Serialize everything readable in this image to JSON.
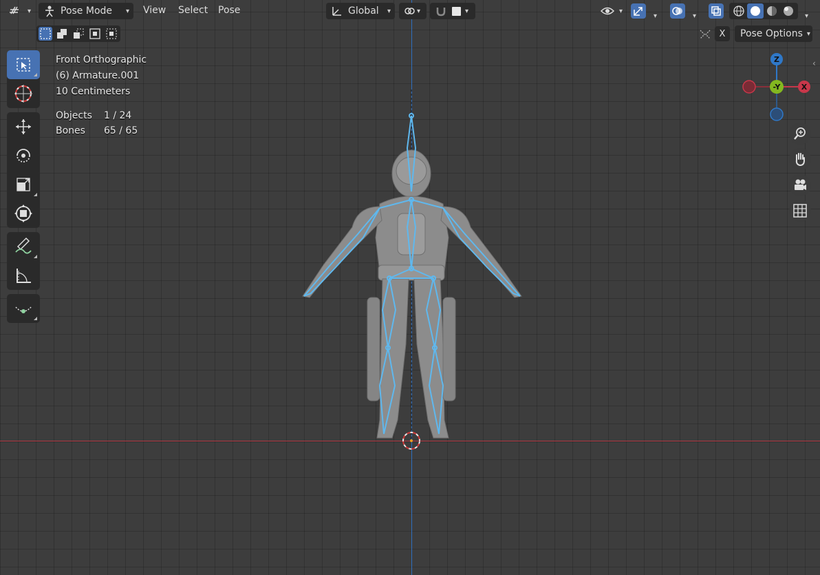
{
  "header": {
    "mode_label": "Pose Mode",
    "menus": [
      "View",
      "Select",
      "Pose"
    ],
    "orientation_label": "Global"
  },
  "overlay": {
    "view_name": "Front Orthographic",
    "object_name": "(6) Armature.001",
    "scale": "10 Centimeters",
    "stats": [
      {
        "label": "Objects",
        "value": "1 / 24"
      },
      {
        "label": "Bones",
        "value": "65 / 65"
      }
    ]
  },
  "tool_settings": {
    "x_mirror_label": "X",
    "pose_options_label": "Pose Options"
  },
  "gizmo": {
    "z_label": "Z",
    "y_label": "-Y",
    "x_label": "X"
  },
  "colors": {
    "accent": "#4772b3",
    "bone_highlight": "#5fb8ee",
    "axis_x": "#b33a44",
    "axis_z": "#2f6fbf",
    "gizmo_x": "#c8374a",
    "gizmo_y": "#83b820",
    "gizmo_z": "#2f78c8"
  },
  "toolbar_tools": [
    "select-box",
    "cursor",
    "move",
    "rotate",
    "scale",
    "transform",
    "annotate",
    "measure",
    "bone-size"
  ],
  "nav_buttons": [
    "zoom",
    "pan",
    "camera-view",
    "ortho-toggle"
  ]
}
